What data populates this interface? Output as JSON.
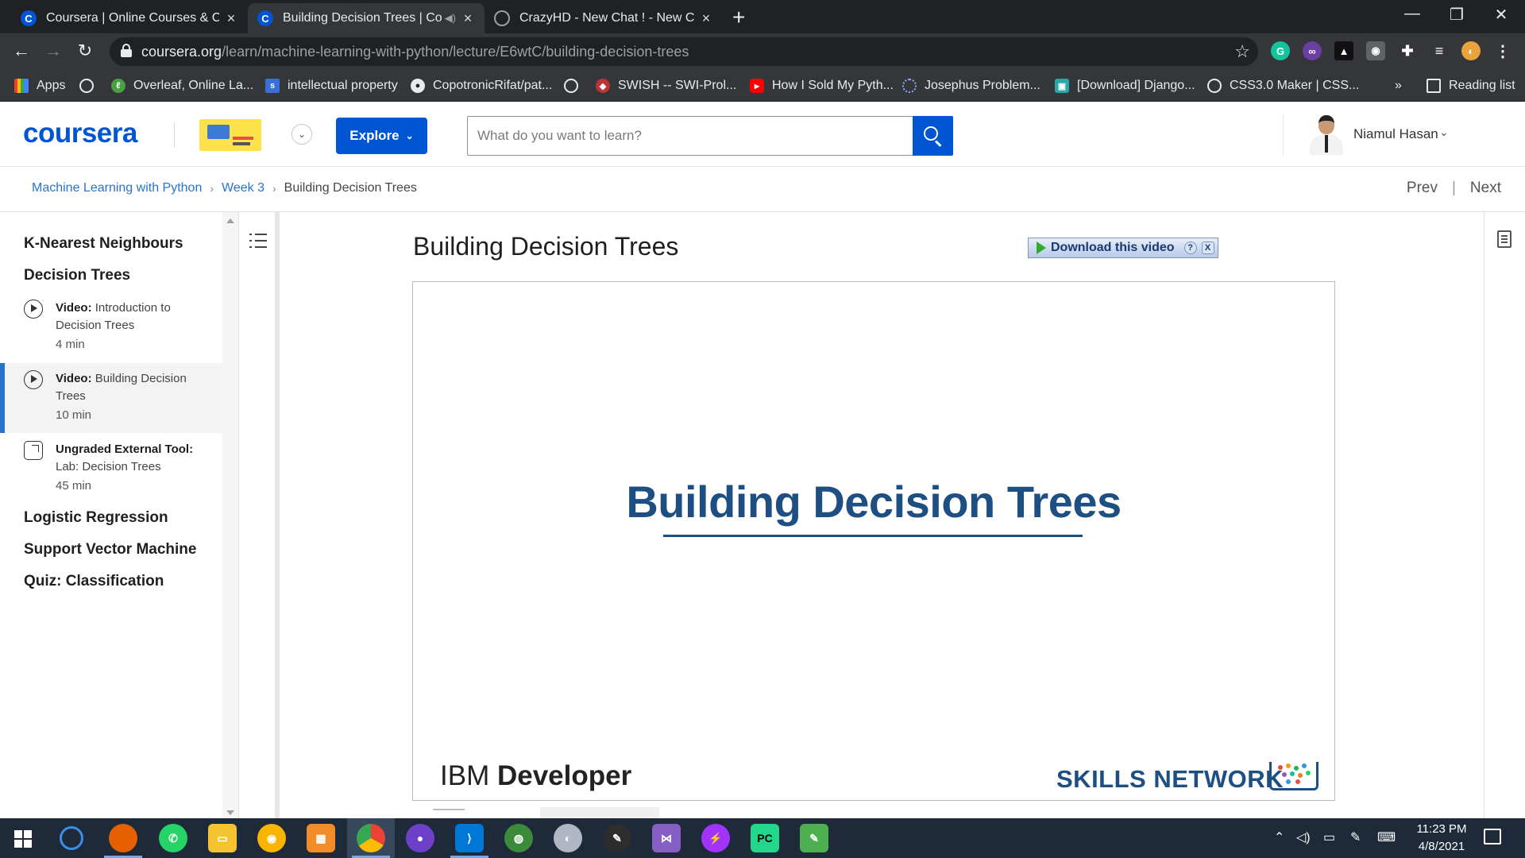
{
  "browser": {
    "tabs": [
      {
        "title": "Coursera | Online Courses & Cre",
        "favicon": "coursera-icon"
      },
      {
        "title": "Building Decision Trees | Cou",
        "favicon": "coursera-icon",
        "active": true
      },
      {
        "title": "CrazyHD - New Chat ! - New Cha",
        "favicon": "globe-icon"
      }
    ],
    "url_host": "coursera.org",
    "url_path": "/learn/machine-learning-with-python/lecture/E6wtC/building-decision-trees",
    "bookmarks": [
      {
        "label": "Apps",
        "icon": "apps-grid-icon"
      },
      {
        "label": "",
        "icon": "globe-icon"
      },
      {
        "label": "Overleaf, Online La...",
        "icon": "overleaf-icon"
      },
      {
        "label": "intellectual property",
        "icon": "bookmark-s-icon"
      },
      {
        "label": "CopotronicRifat/pat...",
        "icon": "github-icon"
      },
      {
        "label": "",
        "icon": "globe-icon"
      },
      {
        "label": "SWISH -- SWI-Prol...",
        "icon": "swish-icon"
      },
      {
        "label": "How I Sold My Pyth...",
        "icon": "youtube-icon"
      },
      {
        "label": "Josephus Problem...",
        "icon": "loading-icon"
      },
      {
        "label": "[Download] Django...",
        "icon": "django-icon"
      },
      {
        "label": "CSS3.0 Maker | CSS...",
        "icon": "globe-icon"
      }
    ],
    "more_bookmarks": "»",
    "reading_list": "Reading list"
  },
  "header": {
    "logo": "coursera",
    "explore_label": "Explore",
    "search_placeholder": "What do you want to learn?",
    "user_name": "Niamul Hasan"
  },
  "breadcrumb": {
    "course": "Machine Learning with Python",
    "week": "Week 3",
    "current": "Building Decision Trees"
  },
  "nav": {
    "prev": "Prev",
    "separator": "|",
    "next": "Next"
  },
  "sidebar": {
    "sections_top": [
      "K-Nearest Neighbours",
      "Decision Trees"
    ],
    "items": [
      {
        "type": "Video:",
        "title": "Introduction to Decision Trees",
        "duration": "4 min"
      },
      {
        "type": "Video:",
        "title": "Building Decision Trees",
        "duration": "10 min"
      },
      {
        "type": "Ungraded External Tool:",
        "title": "Lab: Decision Trees",
        "duration": "45 min"
      }
    ],
    "sections_bottom": [
      "Logistic Regression",
      "Support Vector Machine",
      "Quiz: Classification"
    ]
  },
  "lecture": {
    "title": "Building Decision Trees",
    "download_label": "Download this video",
    "download_help": "?",
    "download_close": "X",
    "slide_title": "Building Decision Trees",
    "slide_brand_left_light": "IBM",
    "slide_brand_left_bold": "Developer",
    "slide_brand_right": "SKILLS NETWORK"
  },
  "taskbar": {
    "time": "11:23 PM",
    "date": "4/8/2021"
  },
  "colors": {
    "brand_blue": "#0056d2",
    "link_blue": "#2a73cc",
    "slide_blue": "#1e4f82"
  }
}
